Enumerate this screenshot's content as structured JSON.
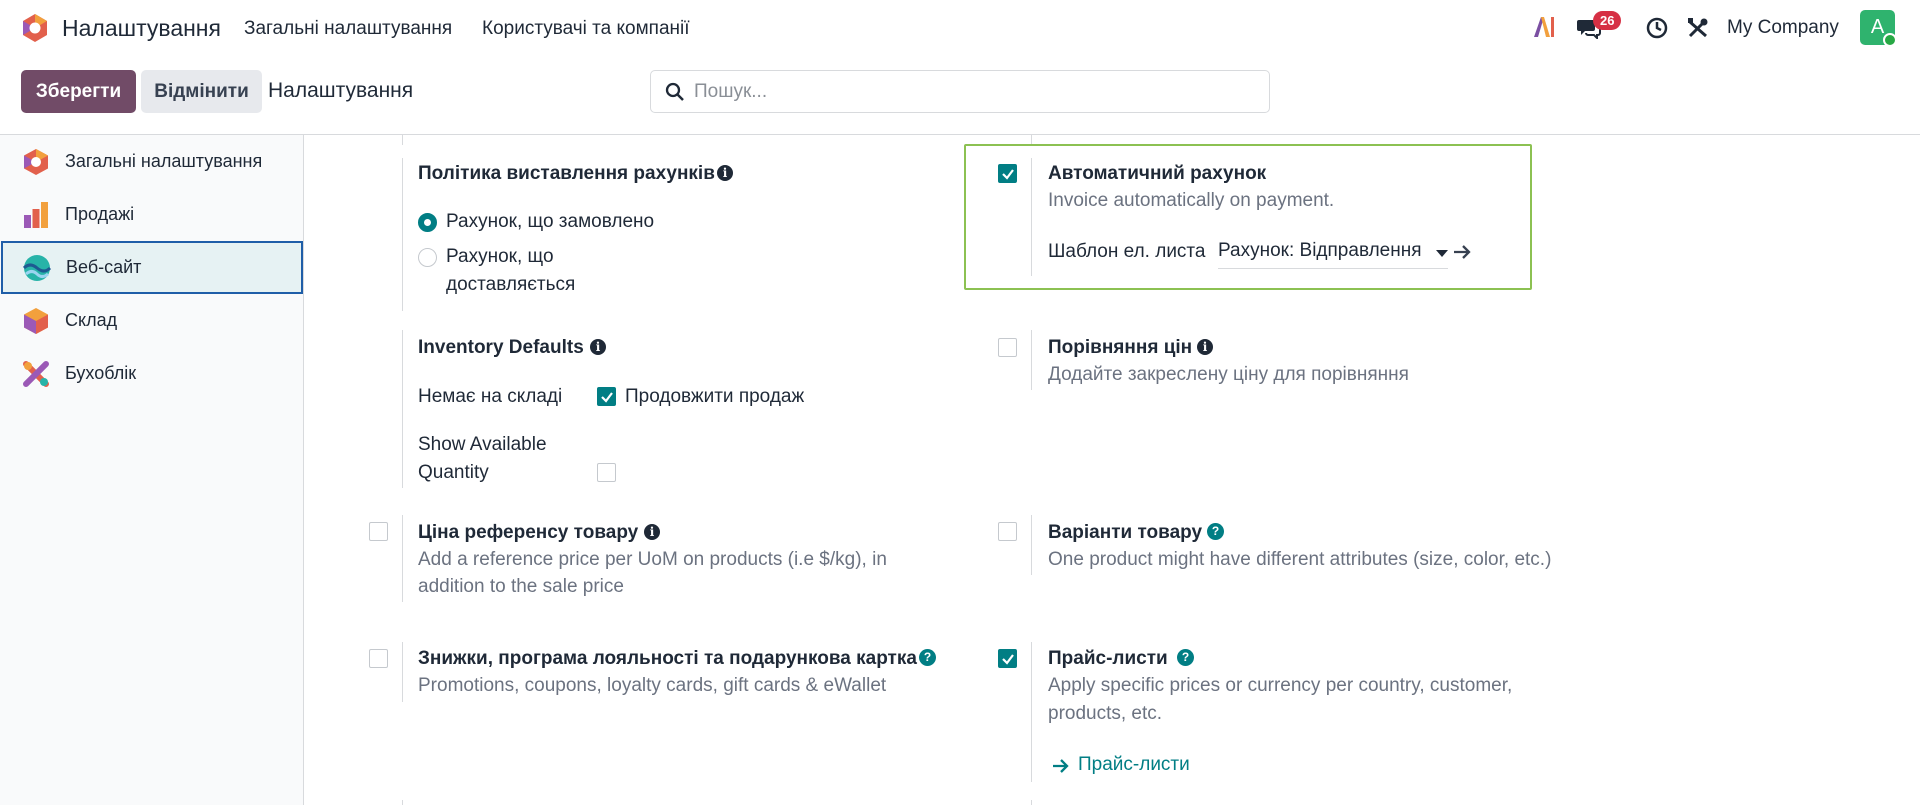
{
  "navbar": {
    "app_name": "Налаштування",
    "menu": [
      "Загальні налаштування",
      "Користувачі та компанії"
    ],
    "messages_count": "26",
    "company": "My Company",
    "avatar_letter": "A"
  },
  "controls": {
    "save_label": "Зберегти",
    "discard_label": "Відмінити",
    "breadcrumb": "Налаштування",
    "search_placeholder": "Пошук..."
  },
  "sidebar": {
    "items": [
      {
        "label": "Загальні налаштування",
        "icon": "settings-app-icon",
        "active": false
      },
      {
        "label": "Продажі",
        "icon": "sales-app-icon",
        "active": false
      },
      {
        "label": "Веб-сайт",
        "icon": "website-app-icon",
        "active": true
      },
      {
        "label": "Склад",
        "icon": "inventory-app-icon",
        "active": false
      },
      {
        "label": "Бухоблік",
        "icon": "accounting-app-icon",
        "active": false
      }
    ]
  },
  "settings": {
    "invoicing_policy": {
      "title": "Політика виставлення рахунків",
      "option1": "Рахунок, що замовлено",
      "option2_line1": "Рахунок, що",
      "option2_line2": "доставляється",
      "selected": "option1"
    },
    "auto_invoice": {
      "title": "Автоматичний рахунок",
      "desc": "Invoice automatically on payment.",
      "checked": true,
      "template_label": "Шаблон ел. листа",
      "template_value": "Рахунок: Відправлення"
    },
    "inventory_defaults": {
      "title": "Inventory Defaults",
      "out_of_stock_label": "Немає на складі",
      "continue_selling": "Продовжити продаж",
      "continue_selling_checked": true,
      "show_qty_line1": "Show Available",
      "show_qty_line2": "Quantity",
      "show_qty_checked": false
    },
    "price_comparison": {
      "title": "Порівняння цін",
      "desc": "Додайте закреслену ціну для порівняння",
      "checked": false
    },
    "product_reference_price": {
      "title": "Ціна референсу товару",
      "desc_line1": "Add a reference price per UoM on products (i.e $/kg), in",
      "desc_line2": "addition to the sale price",
      "checked": false
    },
    "product_variants": {
      "title": "Варіанти товару",
      "desc": "One product might have different attributes (size, color, etc.)",
      "checked": false
    },
    "discounts_loyalty": {
      "title": "Знижки, програма лояльності та подарункова картка",
      "desc": "Promotions, coupons, loyalty cards, gift cards & eWallet",
      "checked": false
    },
    "pricelists": {
      "title": "Прайс-листи",
      "desc_line1": "Apply specific prices or currency per country, customer,",
      "desc_line2": "products, etc.",
      "checked": true,
      "link": "Прайс-листи"
    }
  },
  "colors": {
    "brand": "#714b67",
    "accent": "#017e84",
    "highlight": "#8cc152"
  }
}
